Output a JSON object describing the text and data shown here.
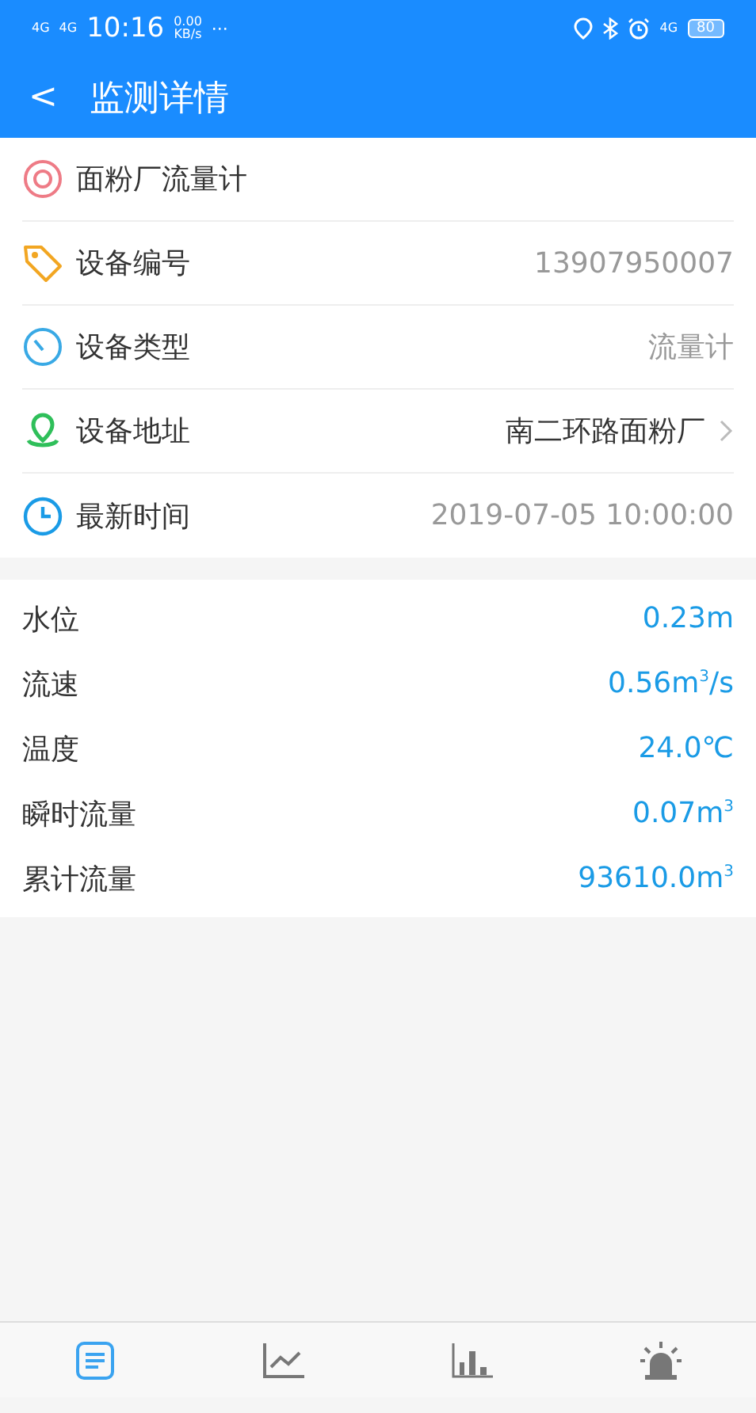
{
  "status_bar": {
    "signal_1": "4G",
    "signal_2": "4G",
    "time": "10:16",
    "speed": "0.00",
    "speed_unit": "KB/s",
    "more": "···",
    "network": "4G",
    "battery": "80"
  },
  "header": {
    "back": "<",
    "title": "监测详情"
  },
  "info": [
    {
      "kind": "device",
      "label": "面粉厂流量计",
      "link": false
    },
    {
      "kind": "tag",
      "label": "设备编号",
      "value": "13907950007",
      "link": false
    },
    {
      "kind": "gauge",
      "label": "设备类型",
      "value": "流量计",
      "link": false
    },
    {
      "kind": "location",
      "label": "设备地址",
      "value": "南二环路面粉厂",
      "link": true
    },
    {
      "kind": "clock",
      "label": "最新时间",
      "value": "2019-07-05 10:00:00",
      "link": false
    }
  ],
  "readings": [
    {
      "label": "水位",
      "value": "0.23m"
    },
    {
      "label": "流速",
      "value": "0.56m$^{3}$/s"
    },
    {
      "label": "温度",
      "value": "24.0℃"
    },
    {
      "label": "瞬时流量",
      "value": "0.07m$^{3}$"
    },
    {
      "label": "累计流量",
      "value": "93610.0m$^{3}$"
    }
  ],
  "tabs": [
    {
      "kind": "list",
      "selected": true
    },
    {
      "kind": "line",
      "selected": false
    },
    {
      "kind": "bars",
      "selected": false
    },
    {
      "kind": "alarm",
      "selected": false
    }
  ]
}
